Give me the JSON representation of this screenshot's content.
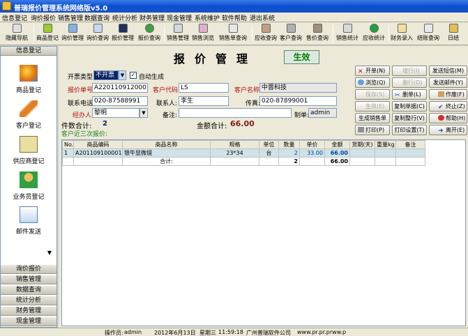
{
  "window": {
    "title": "普瑞报价管理系统网络版v5.0"
  },
  "menu": [
    "信息登记",
    "询价报价",
    "销售管理",
    "数据查询",
    "统计分析",
    "财务管理",
    "现金管理",
    "系统维护",
    "软件帮助",
    "退出系统"
  ],
  "toolbar": [
    "隐藏导航",
    "商品登记",
    "询价管理",
    "询价查询",
    "报价管理",
    "报价查询",
    "销售管理",
    "销售浏览",
    "销售单查询",
    "应收查询",
    "客户查询",
    "售价查询",
    "销售统计",
    "应收统计",
    "财务录入",
    "结账查询",
    "日结"
  ],
  "nav": {
    "header": "信息登记",
    "items": [
      "商品登记",
      "客户登记",
      "供应商登记",
      "业务员登记",
      "邮件发送"
    ],
    "scroll_glyph": "▼",
    "groups": [
      "询价报价",
      "销售管理",
      "数据查询",
      "统计分析",
      "财务管理",
      "现金管理"
    ]
  },
  "form": {
    "title": "报价管理",
    "status": "生效",
    "invoice_type_label": "开票类型:",
    "invoice_type_value": "不开票",
    "auto_generate_label": "自动生成",
    "quote_no_label": "报价单号:",
    "quote_no": "A2201109120001",
    "customer_code_label": "客户代码:",
    "customer_code": "LS",
    "customer_name_label": "客户名称:",
    "customer_name": "中晋科技",
    "phone_label": "联系电话:",
    "phone": "020-87588991",
    "contact_label": "联系人:",
    "contact": "李生",
    "fax_label": "传真:",
    "fax": "020-87899001",
    "handler_label": "经办人:",
    "handler": "黎明",
    "remark_label": "备注:",
    "remark": "",
    "creator_label": "制单:",
    "creator": "admin",
    "count_label": "件数合计:",
    "count": "2",
    "amount_label": "金额合计:",
    "amount": "66.00",
    "recent_label": "客户近三次报价:"
  },
  "buttons": {
    "new": "开单(N)",
    "save_disabled": "增行(I)",
    "send_sms": "发送短信(M)",
    "browse": "浏览(Q)",
    "delete_row": "删行(D)",
    "send_email": "发送邮件(Y)",
    "save": "保存(S)",
    "delete": "删单(L)",
    "void": "作废(F)",
    "effect": "生效(E)",
    "copy_doc": "复制单据(C)",
    "stop": "终止(Z)",
    "gen_sales": "生成销售单",
    "copy_all": "复制整行(V)",
    "help": "帮助(H)",
    "print": "打印(P)",
    "print_setup": "打印设置(T)",
    "exit": "离开(E)"
  },
  "grid": {
    "headers": [
      "No.",
      "商品编码",
      "商品名称",
      "规格",
      "单位",
      "数量",
      "单价",
      "金额",
      "货期(天)",
      "重量kg",
      "备注"
    ],
    "rows": [
      [
        "1",
        "A201109100001",
        "银牛显微镜",
        "23*34",
        "台",
        "2",
        "33.00",
        "66.00",
        "",
        "",
        ""
      ]
    ],
    "total": [
      "",
      "",
      "合计:",
      "",
      "",
      "2",
      "",
      "66.00",
      "",
      "",
      ""
    ]
  },
  "statusbar": {
    "operator_label": "操作员:",
    "operator": "admin",
    "date": "2012年6月13日",
    "weekday": "星期三",
    "time": "11:59:18",
    "company": "广州普瑞软件公司",
    "site": "www.pr.pr.prww.p"
  }
}
